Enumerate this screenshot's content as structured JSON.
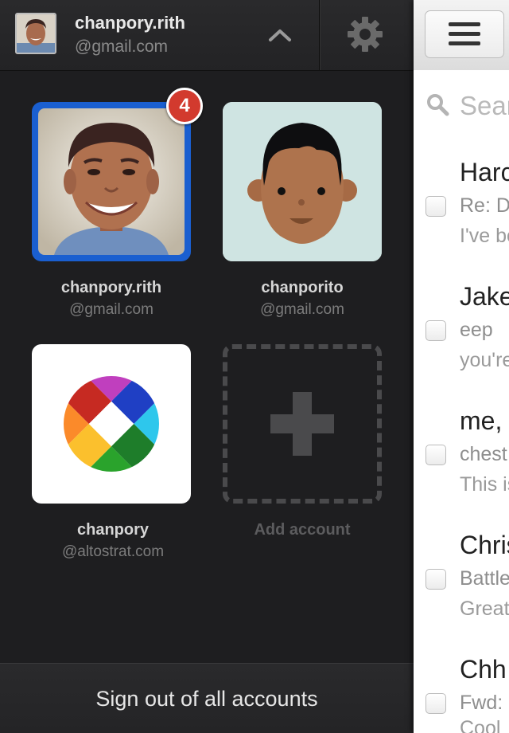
{
  "current_account": {
    "name": "chanpory.rith",
    "domain": "@gmail.com"
  },
  "accounts": [
    {
      "name": "chanpory.rith",
      "domain": "@gmail.com",
      "badge": "4"
    },
    {
      "name": "chanporito",
      "domain": "@gmail.com"
    },
    {
      "name": "chanpory",
      "domain": "@altostrat.com"
    }
  ],
  "add_account_label": "Add account",
  "signout_label": "Sign out of all accounts",
  "search": {
    "placeholder": "Sear"
  },
  "mail": [
    {
      "sender": "Harc",
      "subject": "Re: D",
      "snippet": "I've bo"
    },
    {
      "sender": "Jake",
      "subject": "eep",
      "snippet": "you're"
    },
    {
      "sender": "me,",
      "subject": "chest",
      "snippet": "This is"
    },
    {
      "sender": "Chris",
      "subject": "Battle",
      "snippet": "Great"
    },
    {
      "sender": "Chh",
      "subject": "Fwd:",
      "snippet": "Cool"
    }
  ],
  "colors": {
    "badge": "#d23a2e",
    "selected_tile_border": "#1a5fd0",
    "drawer_background": "#1e1e20"
  },
  "icons": [
    "chevron-up-icon",
    "gear-icon",
    "hamburger-menu-icon",
    "search-icon",
    "plus-icon"
  ]
}
